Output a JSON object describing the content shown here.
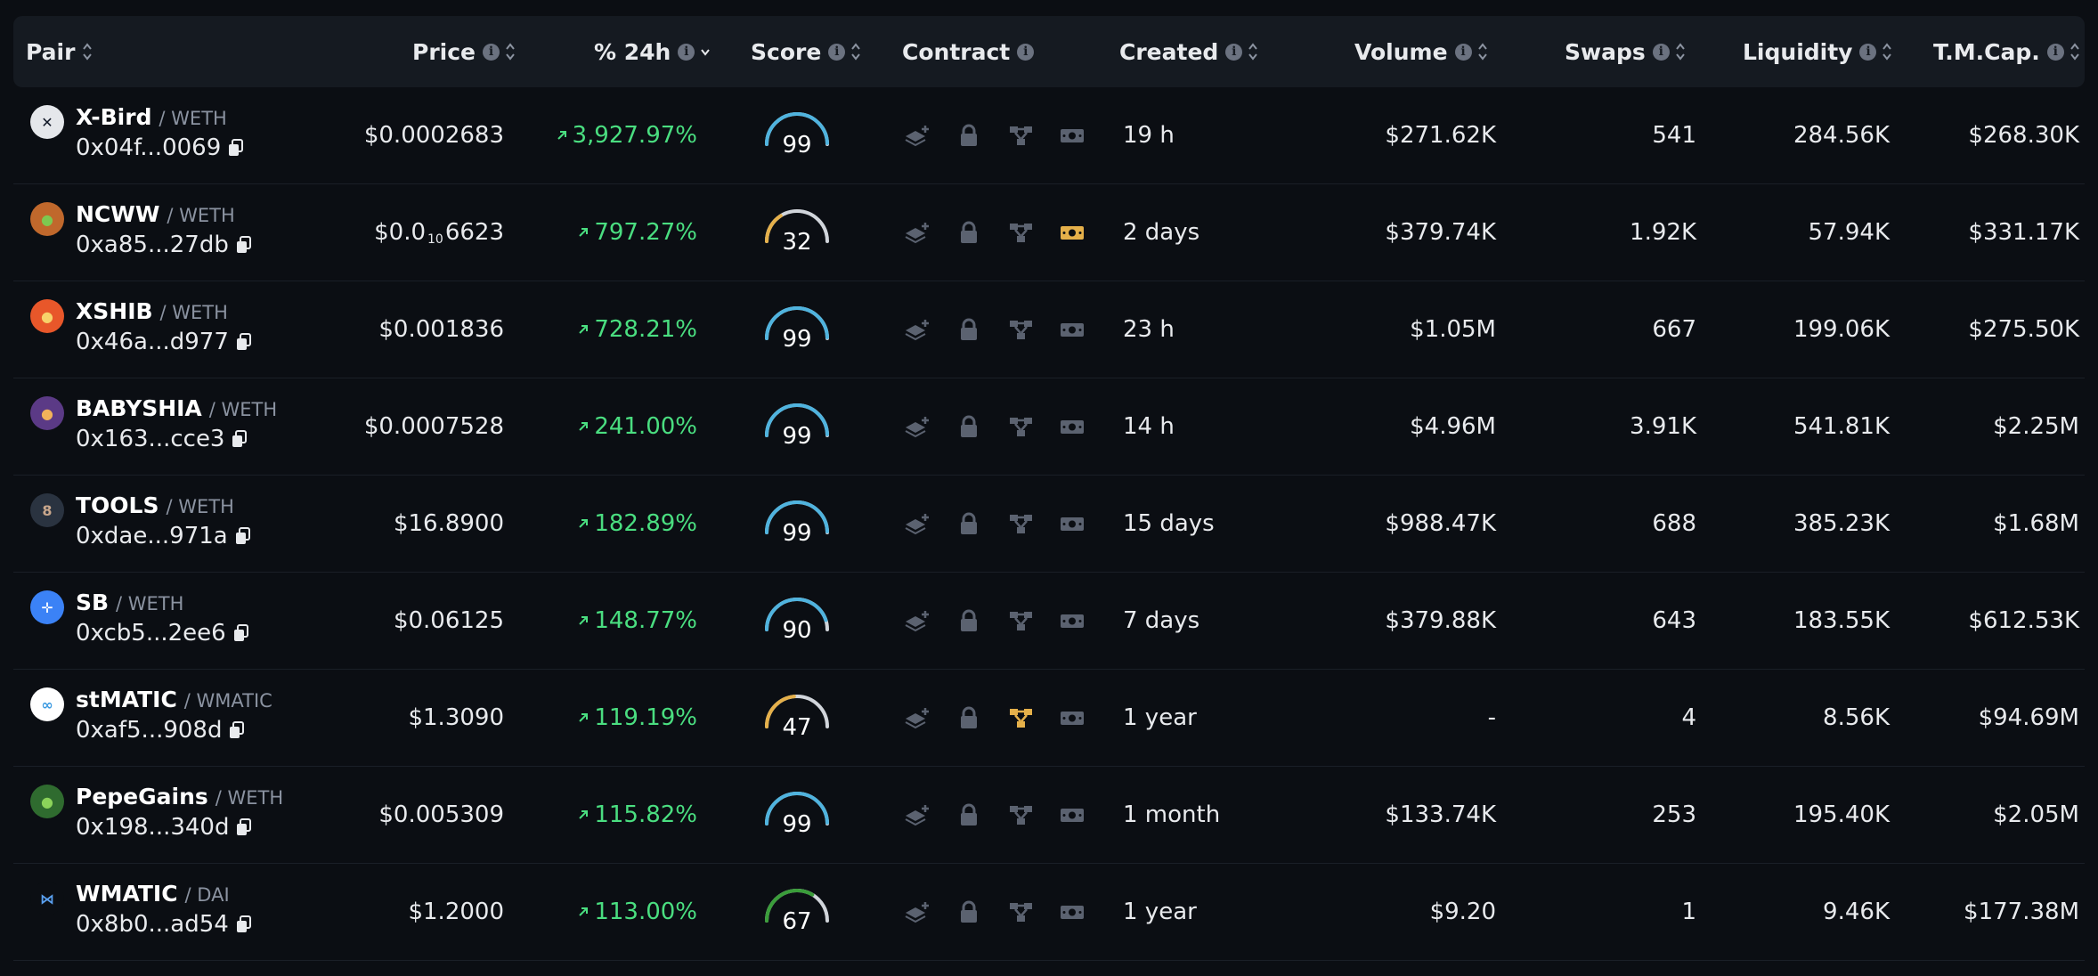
{
  "headers": {
    "pair": "Pair",
    "price": "Price",
    "change": "% 24h",
    "score": "Score",
    "contract": "Contract",
    "created": "Created",
    "volume": "Volume",
    "swaps": "Swaps",
    "liquidity": "Liquidity",
    "tmcap": "T.M.Cap."
  },
  "colors": {
    "positive": "#4ade80",
    "score_high": "#4fb3de",
    "score_mid": "#e5b04a",
    "score_low_green": "#3a9d3a",
    "gauge_track": "#d1d5db",
    "contract_alert": "#e5b04a",
    "contract_default": "#5b6270"
  },
  "rows": [
    {
      "symbol": "X-Bird",
      "quote": "/ WETH",
      "address": "0x04f...0069",
      "price": "$0.0002683",
      "change": "3,927.97%",
      "score": 99,
      "score_color": "score_high",
      "created": "19 h",
      "volume": "$271.62K",
      "swaps": "541",
      "liquidity": "284.56K",
      "tmcap": "$268.30K",
      "alert": "none",
      "avatar_bg": "#e5e7eb",
      "avatar_fg": "#111827",
      "avatar_glyph": "✕"
    },
    {
      "symbol": "NCWW",
      "quote": "/ WETH",
      "address": "0xa85...27db",
      "price_pre": "$0.0",
      "price_sub": "10",
      "price_post": "6623",
      "change": "797.27%",
      "score": 32,
      "score_color": "score_mid",
      "created": "2 days",
      "volume": "$379.74K",
      "swaps": "1.92K",
      "liquidity": "57.94K",
      "tmcap": "$331.17K",
      "alert": "cash",
      "avatar_bg": "#c0682c",
      "avatar_fg": "#7ec850",
      "avatar_glyph": "●"
    },
    {
      "symbol": "XSHIB",
      "quote": "/ WETH",
      "address": "0x46a...d977",
      "price": "$0.001836",
      "change": "728.21%",
      "score": 99,
      "score_color": "score_high",
      "created": "23 h",
      "volume": "$1.05M",
      "swaps": "667",
      "liquidity": "199.06K",
      "tmcap": "$275.50K",
      "alert": "none",
      "avatar_bg": "#e8572a",
      "avatar_fg": "#f7d26a",
      "avatar_glyph": "●"
    },
    {
      "symbol": "BABYSHIA",
      "quote": "/ WETH",
      "address": "0x163...cce3",
      "price": "$0.0007528",
      "change": "241.00%",
      "score": 99,
      "score_color": "score_high",
      "created": "14 h",
      "volume": "$4.96M",
      "swaps": "3.91K",
      "liquidity": "541.81K",
      "tmcap": "$2.25M",
      "alert": "none",
      "avatar_bg": "#5b3a86",
      "avatar_fg": "#f2b35a",
      "avatar_glyph": "●"
    },
    {
      "symbol": "TOOLS",
      "quote": "/ WETH",
      "address": "0xdae...971a",
      "price": "$16.8900",
      "change": "182.89%",
      "score": 99,
      "score_color": "score_high",
      "created": "15 days",
      "volume": "$988.47K",
      "swaps": "688",
      "liquidity": "385.23K",
      "tmcap": "$1.68M",
      "alert": "none",
      "avatar_bg": "#2a3340",
      "avatar_fg": "#c9a78c",
      "avatar_glyph": "8"
    },
    {
      "symbol": "SB",
      "quote": "/ WETH",
      "address": "0xcb5...2ee6",
      "price": "$0.06125",
      "change": "148.77%",
      "score": 90,
      "score_color": "score_high",
      "created": "7 days",
      "volume": "$379.88K",
      "swaps": "643",
      "liquidity": "183.55K",
      "tmcap": "$612.53K",
      "alert": "none",
      "avatar_bg": "#3b82f6",
      "avatar_fg": "#ffffff",
      "avatar_glyph": "✛"
    },
    {
      "symbol": "stMATIC",
      "quote": "/ WMATIC",
      "address": "0xaf5...908d",
      "price": "$1.3090",
      "change": "119.19%",
      "score": 47,
      "score_color": "score_mid",
      "created": "1 year",
      "volume": "-",
      "swaps": "4",
      "liquidity": "8.56K",
      "tmcap": "$94.69M",
      "alert": "network",
      "avatar_bg": "#ffffff",
      "avatar_fg": "#3b9ae1",
      "avatar_glyph": "∞"
    },
    {
      "symbol": "PepeGains",
      "quote": "/ WETH",
      "address": "0x198...340d",
      "price": "$0.005309",
      "change": "115.82%",
      "score": 99,
      "score_color": "score_high",
      "created": "1 month",
      "volume": "$133.74K",
      "swaps": "253",
      "liquidity": "195.40K",
      "tmcap": "$2.05M",
      "alert": "none",
      "avatar_bg": "#2f6b2f",
      "avatar_fg": "#8bd35a",
      "avatar_glyph": "●"
    },
    {
      "symbol": "WMATIC",
      "quote": "/ DAI",
      "address": "0x8b0...ad54",
      "price": "$1.2000",
      "change": "113.00%",
      "score": 67,
      "score_color": "score_low_green",
      "created": "1 year",
      "volume": "$9.20",
      "swaps": "1",
      "liquidity": "9.46K",
      "tmcap": "$177.38M",
      "alert": "none",
      "avatar_bg": "#0b0e13",
      "avatar_fg": "#5aa0f0",
      "avatar_glyph": "⋈"
    }
  ]
}
